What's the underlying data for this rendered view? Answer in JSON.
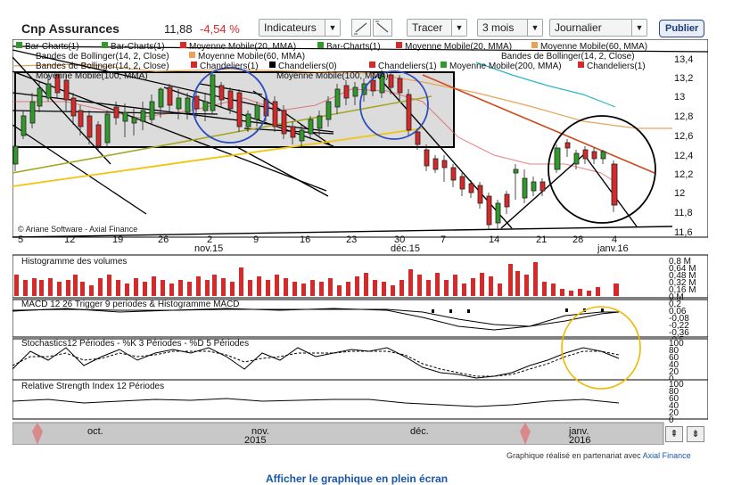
{
  "header": {
    "title": "Cnp Assurances",
    "price": "11,88",
    "change": "-4,54 %",
    "indicators_label": "Indicateurs",
    "draw_label": "Tracer",
    "period_label": "3 mois",
    "interval_label": "Journalier",
    "publish_label": "Publier"
  },
  "legend": {
    "line1": [
      "Bar-Charts(1)",
      "Bar-Charts(1)",
      "Moyenne Mobile(20, MMA)",
      "Bar-Charts(1)",
      "Moyenne Mobile(20, MMA)",
      "Moyenne Mobile(60, MMA)"
    ],
    "line2": [
      "Bandes de Bollinger(14, 2, Close)",
      "Moyenne Mobile(60, MMA)",
      "Bandes de Bollinger(14, 2, Close)"
    ],
    "line3": [
      "Bandes de Bollinger(14, 2, Close)",
      "Chandeliers(1)",
      "Chandeliers(0)",
      "Chandeliers(1)",
      "Moyenne Mobile(200, MMA)",
      "Chandeliers(1)"
    ],
    "line4": [
      "Moyenne Mobile(100, MMA)",
      "Moyenne Mobile(100, MMA)"
    ]
  },
  "price_axis": [
    "13,4",
    "13,2",
    "13",
    "12,8",
    "12,6",
    "12,4",
    "12,2",
    "12",
    "11,8",
    "11,6"
  ],
  "date_labels": [
    "5",
    "12",
    "19",
    "26",
    "2",
    "9",
    "16",
    "23",
    "30",
    "7",
    "14",
    "21",
    "28",
    "4"
  ],
  "month_labels": {
    "nov": "nov.15",
    "dec": "déc.15",
    "jan": "janv.16"
  },
  "copyright": "© Ariane Software - Axial Finance",
  "volume_title": "Histogramme des volumes",
  "volume_axis": [
    "0,8 M",
    "0,64 M",
    "0,48 M",
    "0,32 M",
    "0,16 M",
    "0 M"
  ],
  "macd_title": "MACD 12 26  Trigger 9 periodes & Histogramme MACD",
  "macd_axis": [
    "0,2",
    "0,06",
    "-0,08",
    "-0,22",
    "-0,36",
    "-0,5"
  ],
  "stoch_title": "Stochastics12 Périodes  -  %K 3 Périodes  -  %D 5 Périodes",
  "stoch_axis": [
    "100",
    "80",
    "60",
    "40",
    "20",
    "0"
  ],
  "rsi_title": "Relative Strength Index 12 Périodes",
  "rsi_axis": [
    "100",
    "80",
    "60",
    "40",
    "20",
    "0"
  ],
  "nav_labels": {
    "oct": "oct.",
    "nov": "nov.",
    "y2015": "2015",
    "dec": "déc.",
    "jan": "janv.",
    "y2016": "2016"
  },
  "footer_text": "Graphique réalisé en partenariat avec",
  "footer_link": "Axial Finance",
  "fullscreen_label": "Afficher le graphique en plein écran",
  "colors": {
    "red": "#d62a2a",
    "green": "#2f9a2a",
    "accent": "#1b3a78"
  }
}
